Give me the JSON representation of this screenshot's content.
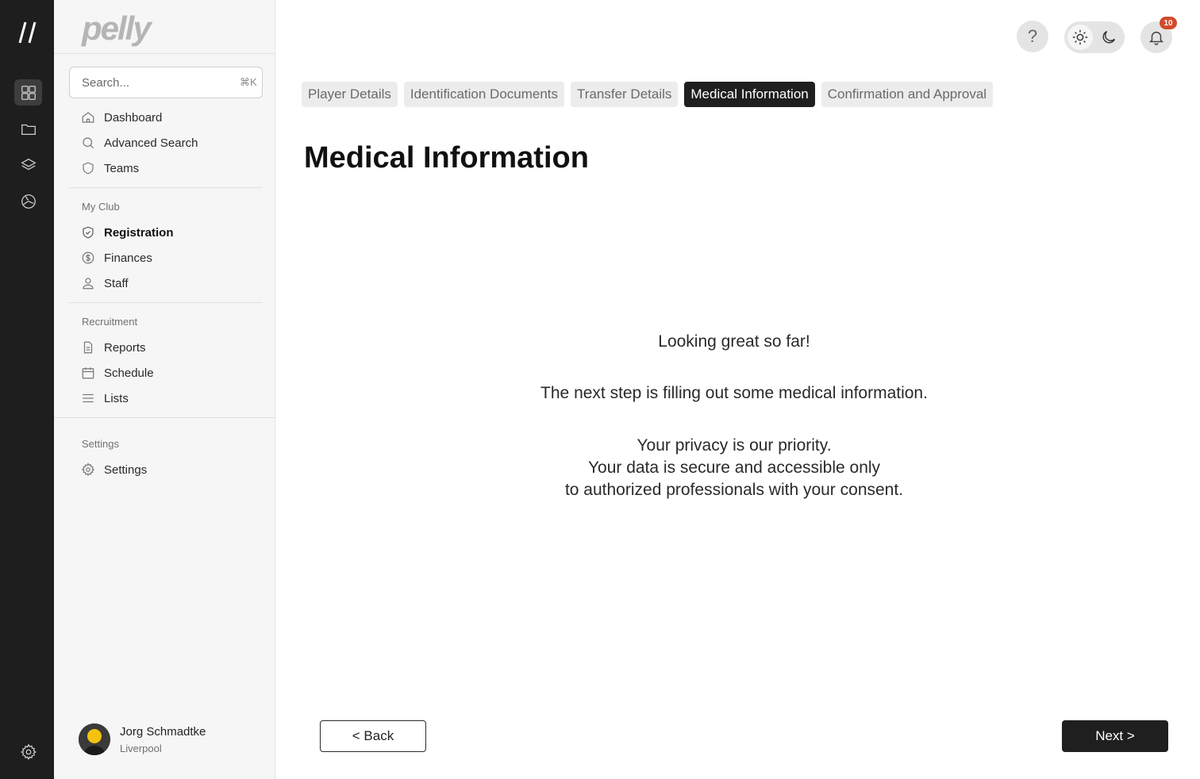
{
  "brand": {
    "name": "pelly"
  },
  "rail": {
    "items": [
      {
        "icon": "grid-icon",
        "active": true
      },
      {
        "icon": "folder-icon",
        "active": false
      },
      {
        "icon": "layers-icon",
        "active": false
      },
      {
        "icon": "globe-icon",
        "active": false
      }
    ],
    "bottom_icon": "gear-icon"
  },
  "search": {
    "placeholder": "Search...",
    "shortcut": "⌘K"
  },
  "sidebar": {
    "main_items": [
      {
        "label": "Dashboard",
        "icon": "home-icon"
      },
      {
        "label": "Advanced Search",
        "icon": "search-icon"
      },
      {
        "label": "Teams",
        "icon": "shield-icon"
      }
    ],
    "my_club": {
      "label": "My Club",
      "items": [
        {
          "label": "Registration",
          "icon": "shield-check-icon",
          "active": true
        },
        {
          "label": "Finances",
          "icon": "dollar-circle-icon"
        },
        {
          "label": "Staff",
          "icon": "user-icon"
        }
      ]
    },
    "recruitment": {
      "label": "Recruitment",
      "items": [
        {
          "label": "Reports",
          "icon": "document-icon"
        },
        {
          "label": "Schedule",
          "icon": "calendar-icon"
        },
        {
          "label": "Lists",
          "icon": "list-icon"
        }
      ]
    },
    "settings": {
      "label": "Settings",
      "items": [
        {
          "label": "Settings",
          "icon": "gear-icon"
        }
      ]
    }
  },
  "user": {
    "name": "Jorg Schmadtke",
    "location": "Liverpool"
  },
  "header": {
    "help_label": "?",
    "theme": "light",
    "notifications_count": "10"
  },
  "tabs": [
    {
      "label": "Player Details",
      "active": false
    },
    {
      "label": "Identification Documents",
      "active": false
    },
    {
      "label": "Transfer Details",
      "active": false
    },
    {
      "label": "Medical Information",
      "active": true
    },
    {
      "label": "Confirmation and Approval",
      "active": false
    }
  ],
  "main": {
    "title": "Medical Information",
    "line1": "Looking great so far!",
    "line2": "The next step is filling out some medical information.",
    "line3": "Your privacy is our priority.",
    "line4": "Your data is secure and accessible only",
    "line5": "to authorized professionals with your consent."
  },
  "actions": {
    "back_label": "< Back",
    "next_label": "Next >"
  },
  "colors": {
    "rail_bg": "#1e1e1e",
    "active_tab": "#1f1f1f",
    "badge": "#d24a2c"
  }
}
